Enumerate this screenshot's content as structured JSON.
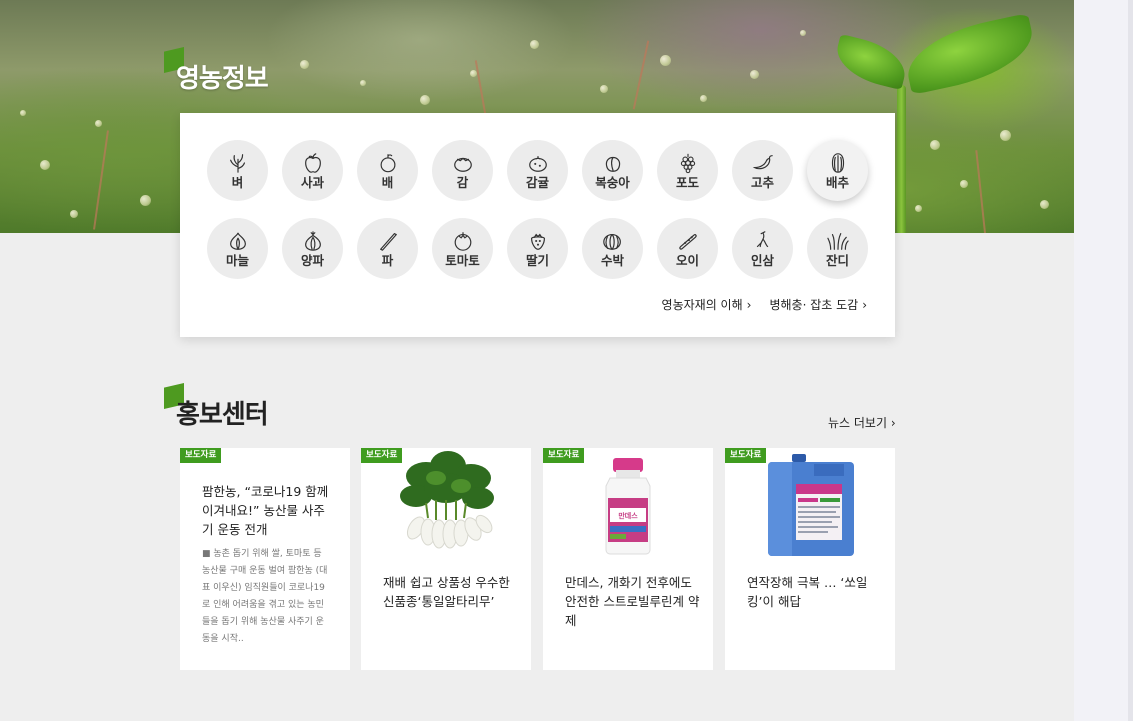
{
  "sections": {
    "info_title": "영농정보",
    "promo_title": "홍보센터"
  },
  "crops": [
    {
      "label": "벼",
      "icon": "rice-icon"
    },
    {
      "label": "사과",
      "icon": "apple-icon"
    },
    {
      "label": "배",
      "icon": "pear-icon"
    },
    {
      "label": "감",
      "icon": "persimmon-icon"
    },
    {
      "label": "감귤",
      "icon": "tangerine-icon"
    },
    {
      "label": "복숭아",
      "icon": "peach-icon"
    },
    {
      "label": "포도",
      "icon": "grape-icon"
    },
    {
      "label": "고추",
      "icon": "pepper-icon"
    },
    {
      "label": "배추",
      "icon": "cabbage-icon"
    },
    {
      "label": "마늘",
      "icon": "garlic-icon"
    },
    {
      "label": "양파",
      "icon": "onion-icon"
    },
    {
      "label": "파",
      "icon": "scallion-icon"
    },
    {
      "label": "토마토",
      "icon": "tomato-icon"
    },
    {
      "label": "딸기",
      "icon": "strawberry-icon"
    },
    {
      "label": "수박",
      "icon": "watermelon-icon"
    },
    {
      "label": "오이",
      "icon": "cucumber-icon"
    },
    {
      "label": "인삼",
      "icon": "ginseng-icon"
    },
    {
      "label": "잔디",
      "icon": "grass-icon"
    }
  ],
  "panel_links": {
    "materials": "영농자재의 이해",
    "pests": "병해충· 잡초 도감",
    "arrow": "›"
  },
  "news_more": "뉴스 더보기 ›",
  "cards": [
    {
      "tag": "보도자료",
      "title": "팜한농, “코로나19 함께 이겨내요!” 농산물 사주기 운동 전개",
      "summary": "■ 농촌 돕기 위해 쌀, 토마토 등 농산물 구매 운동 벌여 팜한농 (대표 이우신) 임직원들이 코로나19로 인해 어려움을 겪고 있는 농민들을 돕기 위해 농산물 사주기 운동을 시작.."
    },
    {
      "tag": "보도자료",
      "title": "재배 쉽고 상품성 우수한 신품종‘통일알타리무’",
      "image": "radish-bunch"
    },
    {
      "tag": "보도자료",
      "title": "만데스, 개화기 전후에도 안전한 스트로빌루린계 약제",
      "image": "pesticide-bottle",
      "product_label": "만데스"
    },
    {
      "tag": "보도자료",
      "title": "연작장해 극복 … ‘쏘일킹’이 해답",
      "image": "blue-jerrycan"
    }
  ],
  "colors": {
    "accent_green": "#4e9a20",
    "tag_green": "#3f9c1f",
    "background": "#eeeeee"
  }
}
